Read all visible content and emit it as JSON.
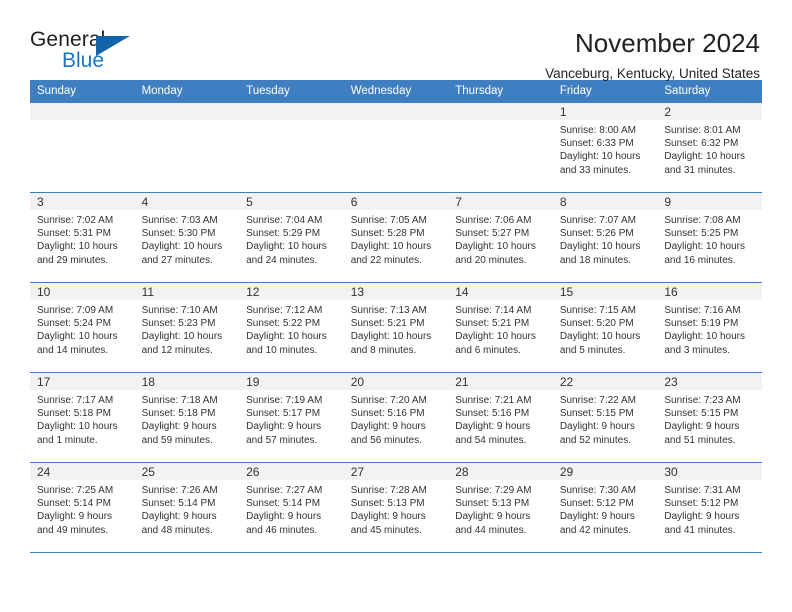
{
  "logo": {
    "text_primary": "General",
    "text_secondary": "Blue",
    "triangle_color": "#1464aa",
    "secondary_color": "#1a76c4"
  },
  "header": {
    "month_title": "November 2024",
    "location": "Vanceburg, Kentucky, United States"
  },
  "colors": {
    "header_band": "#3f7fc1",
    "daynum_band": "#f2f2f2",
    "cell_background": "#ffffff",
    "text": "#333333"
  },
  "calendar": {
    "weekday_headers": [
      "Sunday",
      "Monday",
      "Tuesday",
      "Wednesday",
      "Thursday",
      "Friday",
      "Saturday"
    ],
    "weeks": [
      [
        {
          "day": "",
          "lines": []
        },
        {
          "day": "",
          "lines": []
        },
        {
          "day": "",
          "lines": []
        },
        {
          "day": "",
          "lines": []
        },
        {
          "day": "",
          "lines": []
        },
        {
          "day": "1",
          "lines": [
            "Sunrise: 8:00 AM",
            "Sunset: 6:33 PM",
            "Daylight: 10 hours",
            "and 33 minutes."
          ]
        },
        {
          "day": "2",
          "lines": [
            "Sunrise: 8:01 AM",
            "Sunset: 6:32 PM",
            "Daylight: 10 hours",
            "and 31 minutes."
          ]
        }
      ],
      [
        {
          "day": "3",
          "lines": [
            "Sunrise: 7:02 AM",
            "Sunset: 5:31 PM",
            "Daylight: 10 hours",
            "and 29 minutes."
          ]
        },
        {
          "day": "4",
          "lines": [
            "Sunrise: 7:03 AM",
            "Sunset: 5:30 PM",
            "Daylight: 10 hours",
            "and 27 minutes."
          ]
        },
        {
          "day": "5",
          "lines": [
            "Sunrise: 7:04 AM",
            "Sunset: 5:29 PM",
            "Daylight: 10 hours",
            "and 24 minutes."
          ]
        },
        {
          "day": "6",
          "lines": [
            "Sunrise: 7:05 AM",
            "Sunset: 5:28 PM",
            "Daylight: 10 hours",
            "and 22 minutes."
          ]
        },
        {
          "day": "7",
          "lines": [
            "Sunrise: 7:06 AM",
            "Sunset: 5:27 PM",
            "Daylight: 10 hours",
            "and 20 minutes."
          ]
        },
        {
          "day": "8",
          "lines": [
            "Sunrise: 7:07 AM",
            "Sunset: 5:26 PM",
            "Daylight: 10 hours",
            "and 18 minutes."
          ]
        },
        {
          "day": "9",
          "lines": [
            "Sunrise: 7:08 AM",
            "Sunset: 5:25 PM",
            "Daylight: 10 hours",
            "and 16 minutes."
          ]
        }
      ],
      [
        {
          "day": "10",
          "lines": [
            "Sunrise: 7:09 AM",
            "Sunset: 5:24 PM",
            "Daylight: 10 hours",
            "and 14 minutes."
          ]
        },
        {
          "day": "11",
          "lines": [
            "Sunrise: 7:10 AM",
            "Sunset: 5:23 PM",
            "Daylight: 10 hours",
            "and 12 minutes."
          ]
        },
        {
          "day": "12",
          "lines": [
            "Sunrise: 7:12 AM",
            "Sunset: 5:22 PM",
            "Daylight: 10 hours",
            "and 10 minutes."
          ]
        },
        {
          "day": "13",
          "lines": [
            "Sunrise: 7:13 AM",
            "Sunset: 5:21 PM",
            "Daylight: 10 hours",
            "and 8 minutes."
          ]
        },
        {
          "day": "14",
          "lines": [
            "Sunrise: 7:14 AM",
            "Sunset: 5:21 PM",
            "Daylight: 10 hours",
            "and 6 minutes."
          ]
        },
        {
          "day": "15",
          "lines": [
            "Sunrise: 7:15 AM",
            "Sunset: 5:20 PM",
            "Daylight: 10 hours",
            "and 5 minutes."
          ]
        },
        {
          "day": "16",
          "lines": [
            "Sunrise: 7:16 AM",
            "Sunset: 5:19 PM",
            "Daylight: 10 hours",
            "and 3 minutes."
          ]
        }
      ],
      [
        {
          "day": "17",
          "lines": [
            "Sunrise: 7:17 AM",
            "Sunset: 5:18 PM",
            "Daylight: 10 hours",
            "and 1 minute."
          ]
        },
        {
          "day": "18",
          "lines": [
            "Sunrise: 7:18 AM",
            "Sunset: 5:18 PM",
            "Daylight: 9 hours",
            "and 59 minutes."
          ]
        },
        {
          "day": "19",
          "lines": [
            "Sunrise: 7:19 AM",
            "Sunset: 5:17 PM",
            "Daylight: 9 hours",
            "and 57 minutes."
          ]
        },
        {
          "day": "20",
          "lines": [
            "Sunrise: 7:20 AM",
            "Sunset: 5:16 PM",
            "Daylight: 9 hours",
            "and 56 minutes."
          ]
        },
        {
          "day": "21",
          "lines": [
            "Sunrise: 7:21 AM",
            "Sunset: 5:16 PM",
            "Daylight: 9 hours",
            "and 54 minutes."
          ]
        },
        {
          "day": "22",
          "lines": [
            "Sunrise: 7:22 AM",
            "Sunset: 5:15 PM",
            "Daylight: 9 hours",
            "and 52 minutes."
          ]
        },
        {
          "day": "23",
          "lines": [
            "Sunrise: 7:23 AM",
            "Sunset: 5:15 PM",
            "Daylight: 9 hours",
            "and 51 minutes."
          ]
        }
      ],
      [
        {
          "day": "24",
          "lines": [
            "Sunrise: 7:25 AM",
            "Sunset: 5:14 PM",
            "Daylight: 9 hours",
            "and 49 minutes."
          ]
        },
        {
          "day": "25",
          "lines": [
            "Sunrise: 7:26 AM",
            "Sunset: 5:14 PM",
            "Daylight: 9 hours",
            "and 48 minutes."
          ]
        },
        {
          "day": "26",
          "lines": [
            "Sunrise: 7:27 AM",
            "Sunset: 5:14 PM",
            "Daylight: 9 hours",
            "and 46 minutes."
          ]
        },
        {
          "day": "27",
          "lines": [
            "Sunrise: 7:28 AM",
            "Sunset: 5:13 PM",
            "Daylight: 9 hours",
            "and 45 minutes."
          ]
        },
        {
          "day": "28",
          "lines": [
            "Sunrise: 7:29 AM",
            "Sunset: 5:13 PM",
            "Daylight: 9 hours",
            "and 44 minutes."
          ]
        },
        {
          "day": "29",
          "lines": [
            "Sunrise: 7:30 AM",
            "Sunset: 5:12 PM",
            "Daylight: 9 hours",
            "and 42 minutes."
          ]
        },
        {
          "day": "30",
          "lines": [
            "Sunrise: 7:31 AM",
            "Sunset: 5:12 PM",
            "Daylight: 9 hours",
            "and 41 minutes."
          ]
        }
      ]
    ]
  }
}
